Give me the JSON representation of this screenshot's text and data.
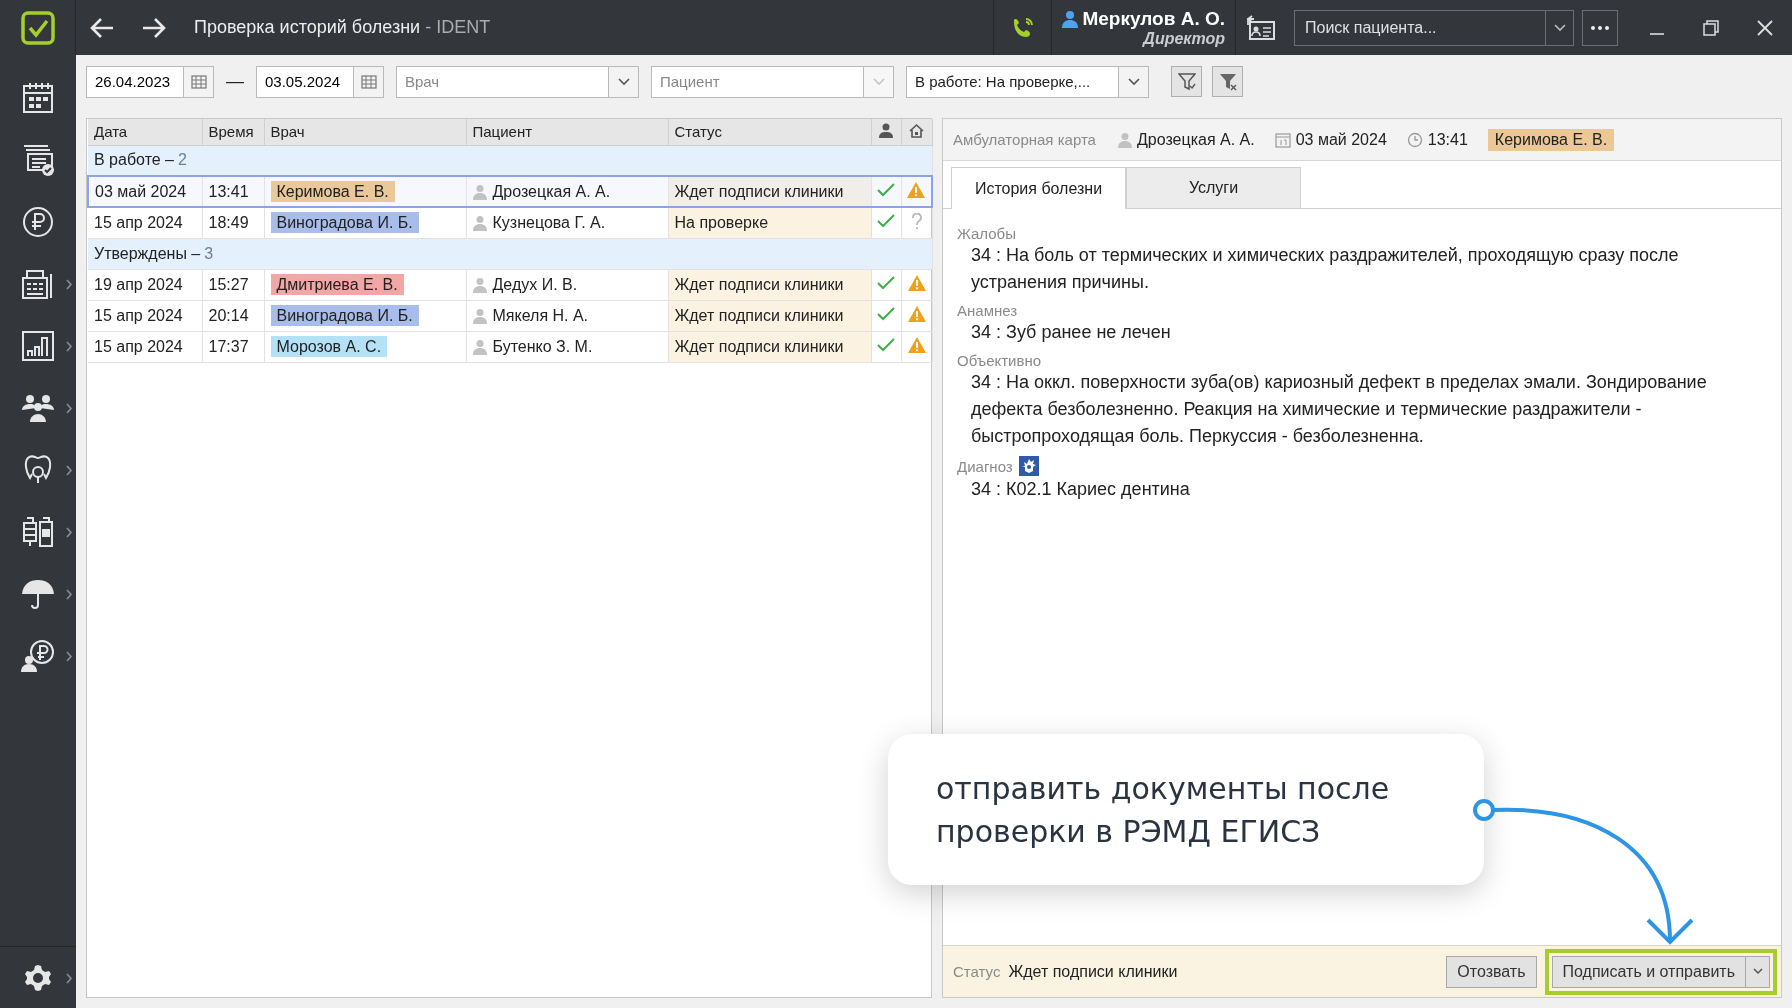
{
  "window": {
    "title": "Проверка историй болезни",
    "app_name": "- IDENT"
  },
  "user": {
    "name": "Меркулов А. О.",
    "role": "Директор"
  },
  "patient_search": {
    "placeholder": "Поиск пациента..."
  },
  "sidebar": {
    "items": [
      {
        "has_submenu": false
      },
      {
        "has_submenu": false
      },
      {
        "has_submenu": false
      },
      {
        "has_submenu": true
      },
      {
        "has_submenu": true
      },
      {
        "has_submenu": true
      },
      {
        "has_submenu": true
      },
      {
        "has_submenu": true
      },
      {
        "has_submenu": true
      },
      {
        "has_submenu": true
      }
    ],
    "settings": {
      "has_submenu": true
    }
  },
  "filters": {
    "date_from": "26.04.2023",
    "separator": "—",
    "date_to": "03.05.2024",
    "doctor": {
      "placeholder": "Врач",
      "disabled": false
    },
    "patient": {
      "placeholder": "Пациент",
      "disabled": true
    },
    "status": {
      "value": "В работе: На проверке,..."
    }
  },
  "table": {
    "columns": [
      "Дата",
      "Время",
      "Врач",
      "Пациент",
      "Статус"
    ],
    "groups": [
      {
        "label": "В работе –",
        "count": "2",
        "rows": [
          {
            "date": "03 май 2024",
            "time": "13:41",
            "doctor": "Керимова Е. В.",
            "color": "#e9c99a",
            "patient": "Дрозецкая А. А.",
            "status": "Ждет подписи клиники",
            "selected": true,
            "verified": true,
            "warning": true
          },
          {
            "date": "15 апр 2024",
            "time": "18:49",
            "doctor": "Виноградова И. Б.",
            "color": "#a9bdea",
            "patient": "Кузнецова Г. А.",
            "status": "На проверке",
            "selected": false,
            "verified": true,
            "warning": false
          }
        ]
      },
      {
        "label": "Утверждены –",
        "count": "3",
        "rows": [
          {
            "date": "19 апр 2024",
            "time": "15:27",
            "doctor": "Дмитриева Е. В.",
            "color": "#f2a6a6",
            "patient": "Дедух И. В.",
            "status": "Ждет подписи клиники",
            "selected": false,
            "verified": true,
            "warning": true
          },
          {
            "date": "15 апр 2024",
            "time": "20:14",
            "doctor": "Виноградова И. Б.",
            "color": "#a9bdea",
            "patient": "Мякеля Н. А.",
            "status": "Ждет подписи клиники",
            "selected": false,
            "verified": true,
            "warning": true
          },
          {
            "date": "15 апр 2024",
            "time": "17:37",
            "doctor": "Морозов А. С.",
            "color": "#b5e1f6",
            "patient": "Бутенко З. М.",
            "status": "Ждет подписи клиники",
            "selected": false,
            "verified": true,
            "warning": true
          }
        ]
      }
    ]
  },
  "record": {
    "title": "Амбулаторная карта",
    "patient": "Дрозецкая А. А.",
    "date": "03 май 2024",
    "time": "13:41",
    "doctor": "Керимова Е. В.",
    "color": "#ecc994"
  },
  "tabs": [
    {
      "label": "История болезни",
      "selected": true
    },
    {
      "label": "Услуги",
      "selected": false
    }
  ],
  "sections": [
    {
      "kind": "plain",
      "label": "Жалобы",
      "text": "34 : На боль от термических и химических раздражителей, проходящую сразу после устранения причины."
    },
    {
      "kind": "plain",
      "label": "Анамнез",
      "text": "34 : Зуб ранее не лечен"
    },
    {
      "kind": "plain",
      "label": "Объективно",
      "text": "34 : На оккл. поверхности зуба(ов) кариозный дефект в пределах эмали. Зондирование дефекта безболезненно. Реакция на химические и термические раздражители - быстропроходящая боль. Перкуссия - безболезненна."
    },
    {
      "kind": "coded",
      "label": "Диагноз",
      "text": "34 : К02.1 Кариес дентина"
    }
  ],
  "status_bar": {
    "label": "Статус",
    "value": "Ждет подписи клиники",
    "buttons": [
      {
        "label": "Отозвать",
        "kind": "plain",
        "highlighted": false
      },
      {
        "label": "Подписать и отправить",
        "kind": "split",
        "highlighted": true
      }
    ]
  },
  "callout": {
    "text": "отправить документы после проверки в РЭМД ЕГИСЗ"
  }
}
